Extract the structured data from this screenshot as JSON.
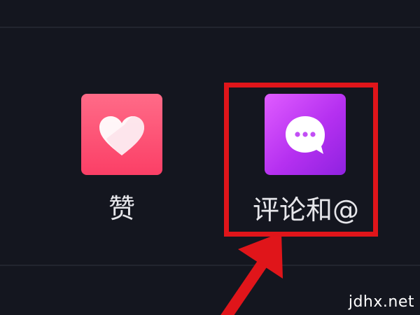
{
  "notifications": {
    "likes": {
      "label": "赞",
      "icon": "heart-icon",
      "color": "#fb4a6d"
    },
    "comments": {
      "label": "评论和@",
      "icon": "chat-bubble-icon",
      "color": "#b530f0"
    }
  },
  "annotation": {
    "highlight_color": "#e0151a"
  },
  "watermark": {
    "text": "jdhx.net"
  },
  "theme": {
    "background": "#14161f"
  }
}
